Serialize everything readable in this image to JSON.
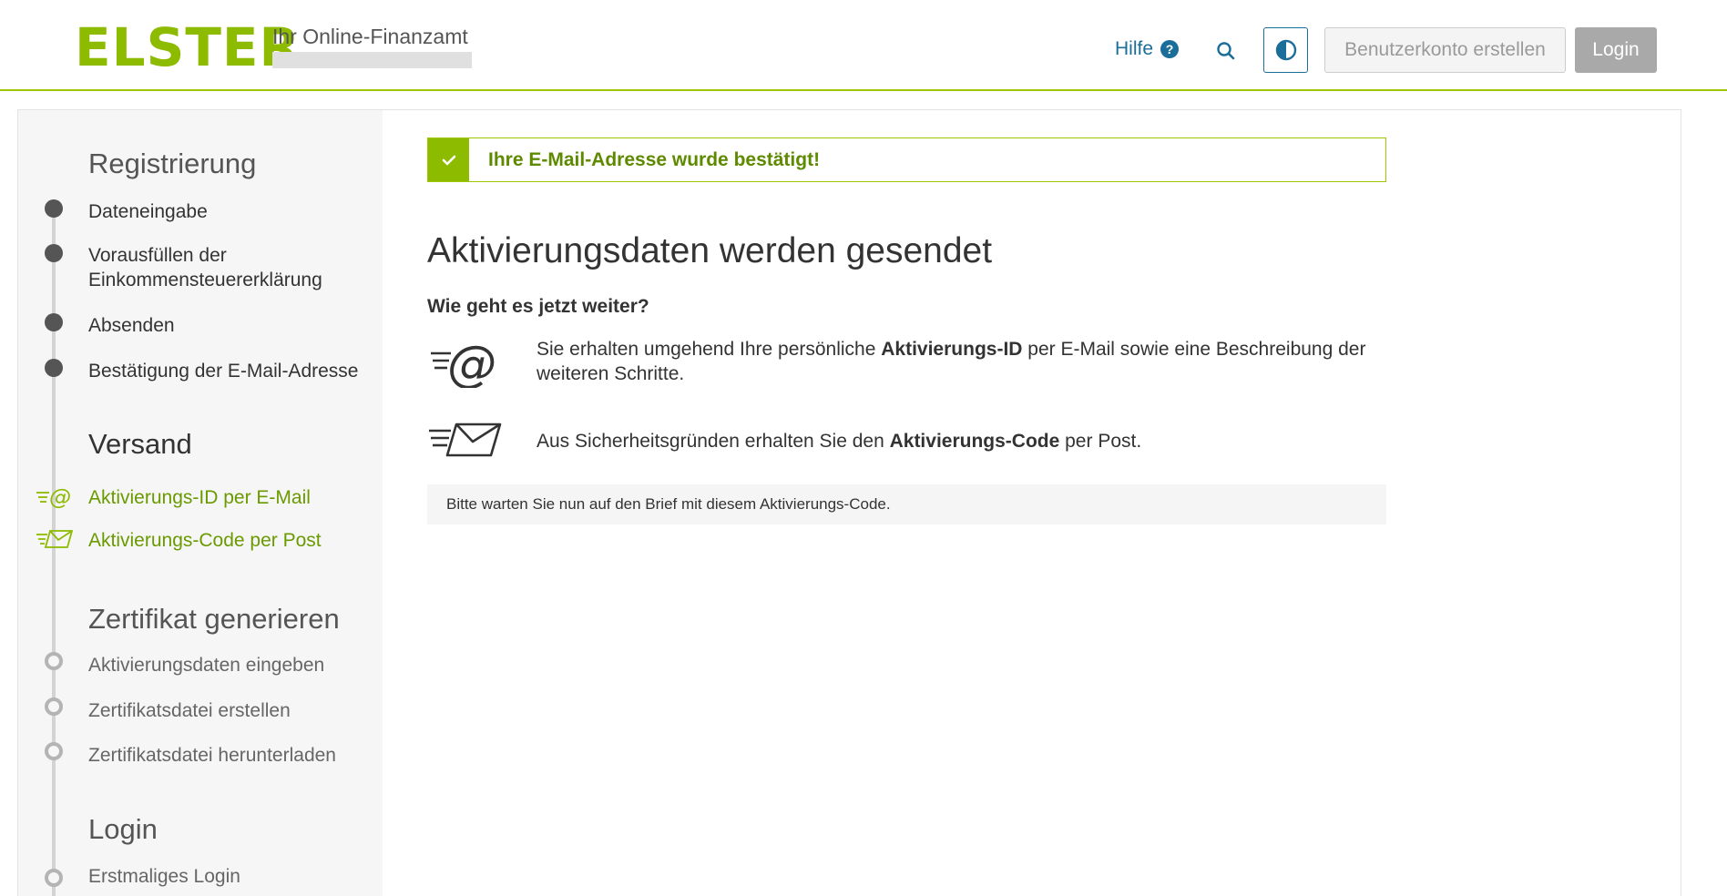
{
  "header": {
    "logo": "ELSTER",
    "subtitle": "Ihr Online-Finanzamt",
    "help_label": "Hilfe",
    "help_icon": "question-circle-icon",
    "search_icon": "search-icon",
    "contrast_icon": "contrast-icon",
    "register_label": "Benutzerkonto erstellen",
    "login_label": "Login"
  },
  "sidebar": {
    "sections": [
      {
        "title": "Registrierung",
        "steps": [
          {
            "label": "Dateneingabe",
            "state": "done"
          },
          {
            "label": "Vorausfüllen der Einkommensteuererklärung",
            "line1": "Vorausfüllen der",
            "line2": "Einkommensteuererklärung",
            "state": "done"
          },
          {
            "label": "Absenden",
            "state": "done"
          },
          {
            "label": "Bestätigung der E-Mail-Adresse",
            "state": "done"
          }
        ]
      },
      {
        "title": "Versand",
        "steps": [
          {
            "label": "Aktivierungs-ID per E-Mail",
            "state": "active",
            "icon": "email-at-icon"
          },
          {
            "label": "Aktivierungs-Code per Post",
            "state": "active",
            "icon": "envelope-icon"
          }
        ]
      },
      {
        "title": "Zertifikat generieren",
        "steps": [
          {
            "label": "Aktivierungsdaten eingeben",
            "state": "pending"
          },
          {
            "label": "Zertifikatsdatei erstellen",
            "state": "pending"
          },
          {
            "label": "Zertifikatsdatei herunterladen",
            "state": "pending"
          }
        ]
      },
      {
        "title": "Login",
        "steps": [
          {
            "label": "Erstmaliges Login",
            "state": "pending"
          }
        ]
      }
    ]
  },
  "main": {
    "alert": {
      "text": "Ihre E-Mail-Adresse wurde bestätigt!",
      "icon": "checkmark-icon"
    },
    "title": "Aktivierungsdaten werden gesendet",
    "question": "Wie geht es jetzt weiter?",
    "info_email": {
      "icon": "email-at-icon",
      "before": "Sie erhalten umgehend Ihre persönliche ",
      "bold": "Aktivierungs-ID",
      "after": " per E-Mail sowie eine Beschreibung der weiteren Schritte."
    },
    "info_post": {
      "icon": "envelope-icon",
      "before": "Aus Sicherheitsgründen erhalten Sie den ",
      "bold": "Aktivierungs-Code",
      "after": " per Post."
    },
    "note": "Bitte warten Sie nun auf den Brief mit diesem Aktivierungs-Code."
  },
  "colors": {
    "brand_green": "#8dbb00",
    "success_text": "#5e8a00",
    "link_blue": "#1a6e99",
    "sidebar_bg": "#f6f6f6"
  }
}
